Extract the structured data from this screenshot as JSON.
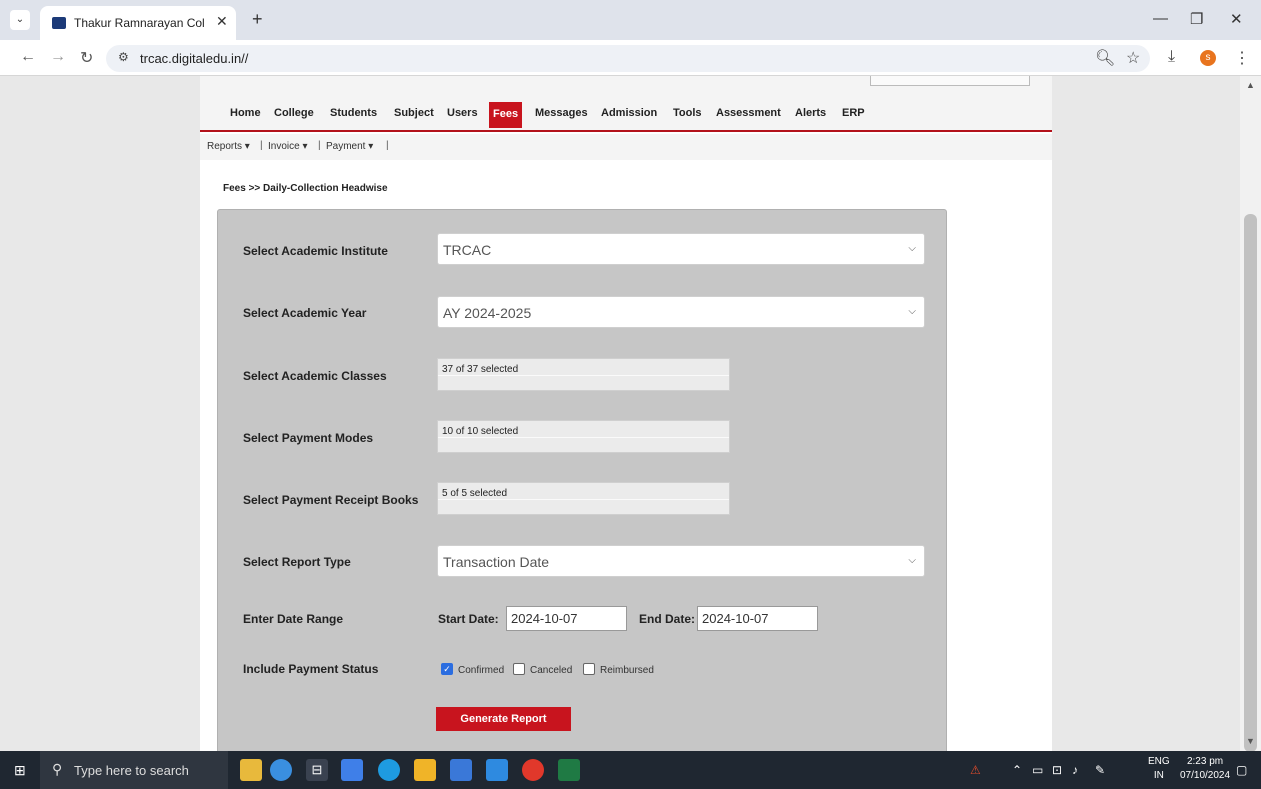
{
  "browser": {
    "tab_title": "Thakur Ramnarayan College of",
    "url": "trcac.digitaledu.in//"
  },
  "menu": {
    "items": [
      "Home",
      "College",
      "Students",
      "Subject",
      "Users",
      "Fees",
      "Messages",
      "Admission",
      "Tools",
      "Assessment",
      "Alerts",
      "ERP"
    ],
    "active": "Fees"
  },
  "submenu": {
    "reports": "Reports ▾",
    "invoice": "Invoice ▾",
    "payment": "Payment ▾",
    "separator": "|"
  },
  "breadcrumb": "Fees >> Daily-Collection Headwise",
  "form": {
    "institute_label": "Select Academic Institute",
    "institute_value": "TRCAC",
    "year_label": "Select Academic Year",
    "year_value": "AY 2024-2025",
    "classes_label": "Select Academic Classes",
    "classes_value": "37 of 37 selected",
    "modes_label": "Select Payment Modes",
    "modes_value": "10 of 10 selected",
    "books_label": "Select Payment Receipt Books",
    "books_value": "5 of 5 selected",
    "report_type_label": "Select Report Type",
    "report_type_value": "Transaction Date",
    "date_range_label": "Enter Date Range",
    "start_date_label": "Start Date:",
    "start_date_value": "2024-10-07",
    "end_date_label": "End Date:",
    "end_date_value": "2024-10-07",
    "status_label": "Include Payment Status",
    "status_confirmed": "Confirmed",
    "status_canceled": "Canceled",
    "status_reimbursed": "Reimbursed",
    "generate_button": "Generate Report"
  },
  "taskbar": {
    "search_placeholder": "Type here to search",
    "lang_top": "ENG",
    "lang_bottom": "IN",
    "time": "2:23 pm",
    "date": "07/10/2024"
  },
  "colors": {
    "accent_red": "#c8141e",
    "panel_gray": "#c6c6c6"
  }
}
